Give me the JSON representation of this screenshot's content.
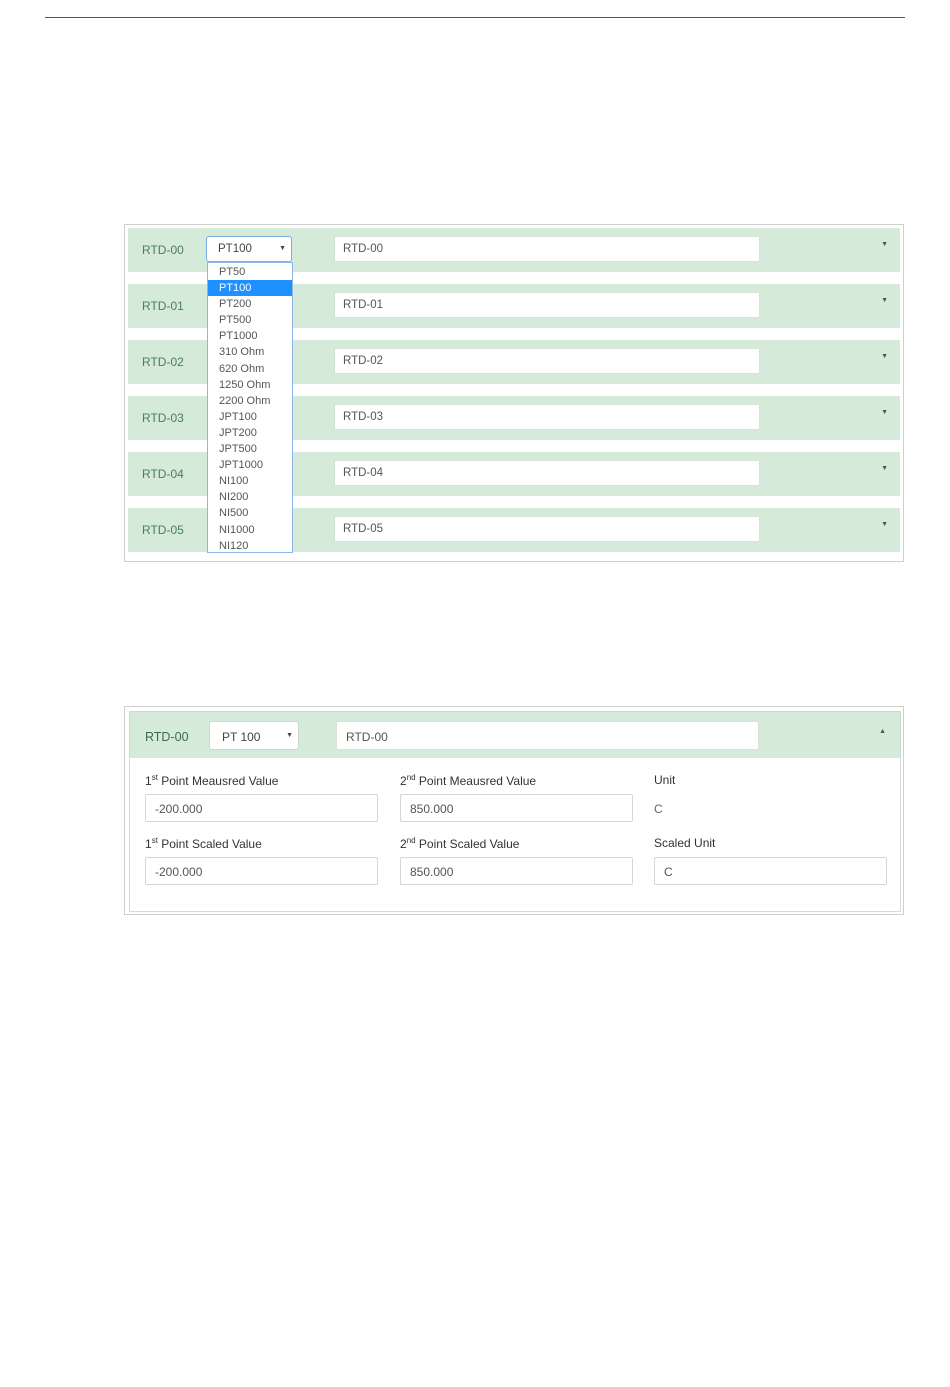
{
  "list": {
    "rows": [
      {
        "label": "RTD-00",
        "type": "PT100",
        "name": "RTD-00"
      },
      {
        "label": "RTD-01",
        "type": "",
        "name": "RTD-01"
      },
      {
        "label": "RTD-02",
        "type": "",
        "name": "RTD-02"
      },
      {
        "label": "RTD-03",
        "type": "",
        "name": "RTD-03"
      },
      {
        "label": "RTD-04",
        "type": "",
        "name": "RTD-04"
      },
      {
        "label": "RTD-05",
        "type": "",
        "name": "RTD-05"
      }
    ],
    "dropdown_options": [
      "PT50",
      "PT100",
      "PT200",
      "PT500",
      "PT1000",
      "310 Ohm",
      "620 Ohm",
      "1250 Ohm",
      "2200 Ohm",
      "JPT100",
      "JPT200",
      "JPT500",
      "JPT1000",
      "NI100",
      "NI200",
      "NI500",
      "NI1000",
      "NI120"
    ],
    "dropdown_selected": "PT100",
    "selected_color": "#1e90ff",
    "row_color": "#d5ead8"
  },
  "detail": {
    "label": "RTD-00",
    "type": "PT 100",
    "name": "RTD-00",
    "p1_measured": {
      "sup": "st",
      "prefix": "1",
      "text": " Point Meausred Value",
      "value": "-200.000"
    },
    "p2_measured": {
      "sup": "nd",
      "prefix": "2",
      "text": " Point Meausred Value",
      "value": "850.000"
    },
    "unit": {
      "label": "Unit",
      "value": "C"
    },
    "p1_scaled": {
      "sup": "st",
      "prefix": "1",
      "text": " Point Scaled Value",
      "value": "-200.000"
    },
    "p2_scaled": {
      "sup": "nd",
      "prefix": "2",
      "text": " Point Scaled Value",
      "value": "850.000"
    },
    "scaled_unit": {
      "label": "Scaled Unit",
      "value": "C"
    }
  },
  "icons": {
    "caret_down": "caret-down-icon",
    "caret_up": "caret-up-icon"
  }
}
